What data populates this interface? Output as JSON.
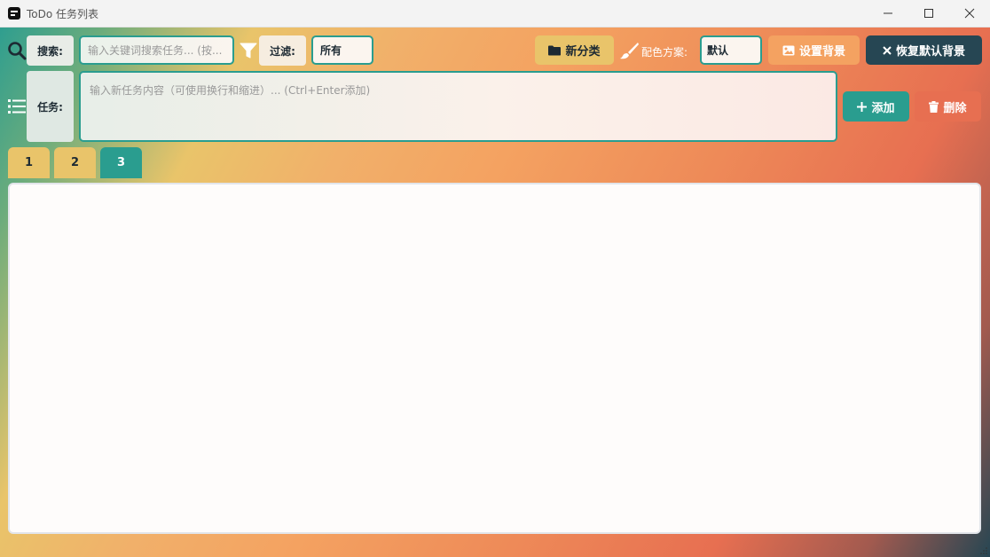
{
  "window": {
    "title": "ToDo 任务列表"
  },
  "toolbar": {
    "search_label": "搜索:",
    "search_placeholder": "输入关键词搜索任务... (按...",
    "filter_label": "过滤:",
    "filter_value": "所有",
    "new_category_label": "新分类",
    "color_scheme_label": "配色方案:",
    "color_scheme_value": "默认",
    "set_background_label": "设置背景",
    "restore_background_label": "恢复默认背景"
  },
  "task_entry": {
    "label": "任务:",
    "placeholder": "输入新任务内容（可使用换行和缩进）... (Ctrl+Enter添加)",
    "add_label": "添加",
    "delete_label": "删除"
  },
  "tabs": [
    {
      "label": "1",
      "active": false
    },
    {
      "label": "2",
      "active": false
    },
    {
      "label": "3",
      "active": true
    }
  ],
  "icons": {
    "search": "search-icon",
    "filter": "filter-icon",
    "folder": "folder-icon",
    "brush": "brush-icon",
    "image": "image-icon",
    "close": "close-icon",
    "list": "list-icon",
    "plus": "plus-icon",
    "trash": "trash-icon"
  },
  "colors": {
    "teal": "#2a9d8f",
    "yellow": "#e9c46a",
    "orange": "#f4a261",
    "coral": "#e76f51",
    "dark": "#264653"
  }
}
